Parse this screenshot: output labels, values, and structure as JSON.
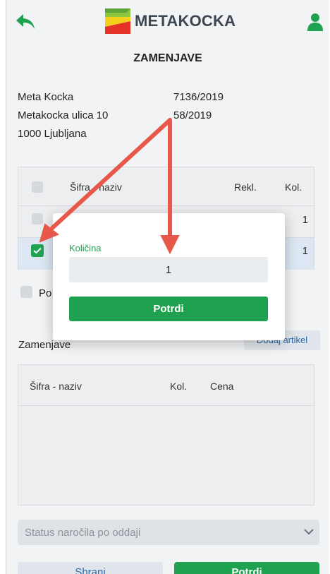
{
  "header": {
    "brand": "METAKOCKA",
    "back_icon": "back-arrow-icon",
    "user_icon": "user-icon"
  },
  "page": {
    "title": "ZAMENJAVE"
  },
  "customer": {
    "name": "Meta Kocka",
    "street": "Metakocka ulica 10",
    "city": "1000 Ljubljana"
  },
  "document": {
    "number": "7136/2019",
    "number2": "58/2019"
  },
  "complaint_table": {
    "headers": {
      "code_name": "Šifra - naziv",
      "rekl": "Rekl.",
      "kol": "Kol."
    },
    "rows": [
      {
        "qty": "1",
        "checked": false
      },
      {
        "qty": "1",
        "checked": true
      }
    ]
  },
  "po_label": "Po",
  "replacements": {
    "label": "Zamenjave",
    "add_button": "Dodaj artikel",
    "headers": {
      "code_name": "Šifra - naziv",
      "kol": "Kol.",
      "cena": "Cena"
    }
  },
  "status_select": {
    "placeholder": "Status naročila po oddaji"
  },
  "footer": {
    "save": "Shrani",
    "confirm": "Potrdi"
  },
  "modal": {
    "label": "Količina",
    "value": "1",
    "button": "Potrdi"
  },
  "colors": {
    "accent": "#1fa24f",
    "link": "#2d6aa8",
    "annotation": "#e8584a"
  }
}
